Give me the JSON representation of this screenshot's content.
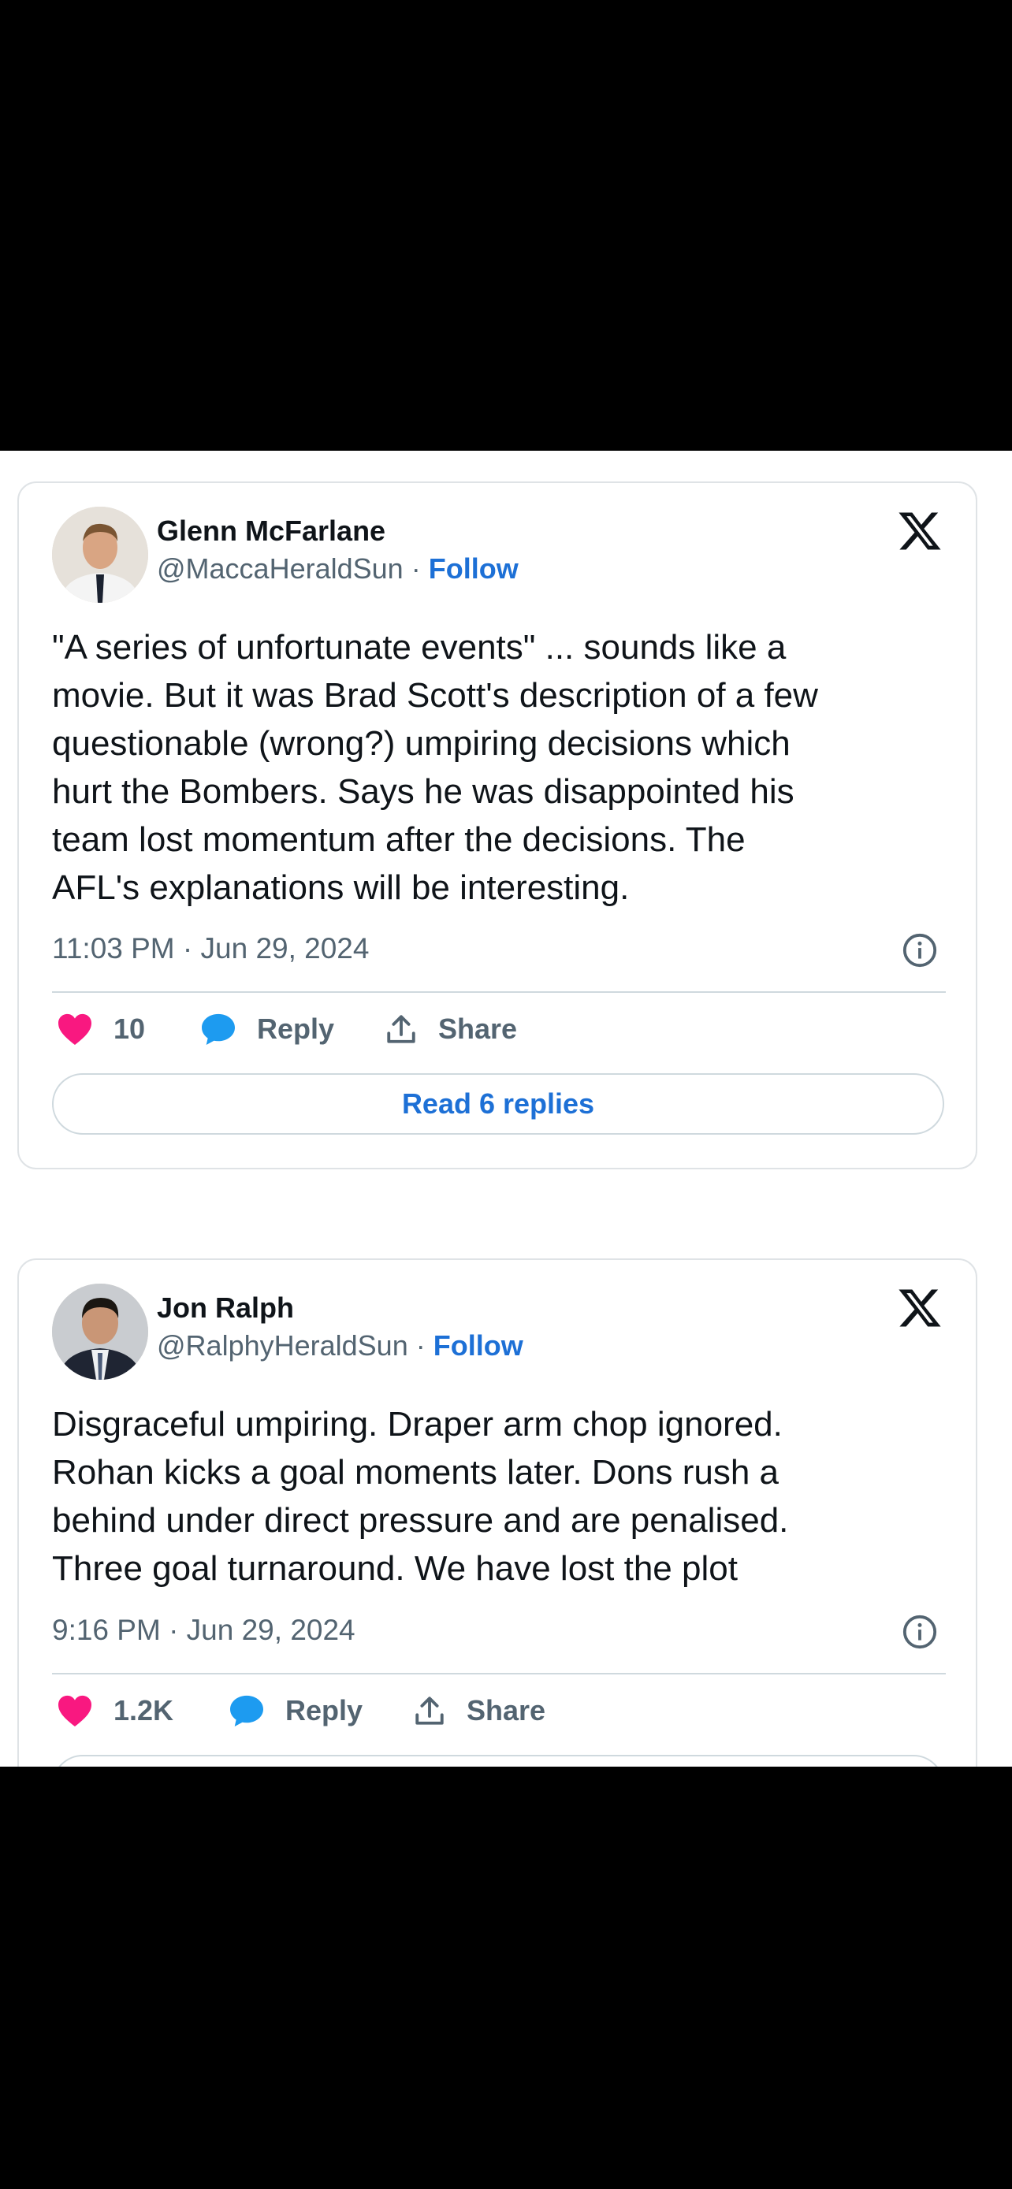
{
  "tweets": [
    {
      "name": "Glenn McFarlane",
      "handle": "@MaccaHeraldSun",
      "separator": "·",
      "follow_label": "Follow",
      "text": "\"A series of unfortunate events\" ... sounds like a\nmovie. But it was Brad Scott's description of a few\nquestionable (wrong?) umpiring decisions which\nhurt the Bombers. Says he was disappointed his\nteam lost momentum after the decisions. The\nAFL's explanations will be interesting.",
      "timestamp": "11:03 PM · Jun 29, 2024",
      "likes": "10",
      "reply_label": "Reply",
      "share_label": "Share",
      "read_replies_label": "Read 6 replies"
    },
    {
      "name": "Jon Ralph",
      "handle": "@RalphyHeraldSun",
      "separator": "·",
      "follow_label": "Follow",
      "text": "Disgraceful umpiring. Draper arm chop ignored.\nRohan kicks a goal moments later. Dons rush a\nbehind under direct pressure and are penalised.\nThree goal turnaround. We have lost the plot",
      "timestamp": "9:16 PM · Jun 29, 2024",
      "likes": "1.2K",
      "reply_label": "Reply",
      "share_label": "Share"
    }
  ],
  "colors": {
    "like_heart": "#f91880",
    "reply_bubble": "#1d9bf0",
    "follow_link": "#1d70d6",
    "background_outside": "#000000"
  },
  "icons": [
    "x-logo-icon",
    "info-icon",
    "heart-icon",
    "reply-bubble-icon",
    "share-icon"
  ]
}
